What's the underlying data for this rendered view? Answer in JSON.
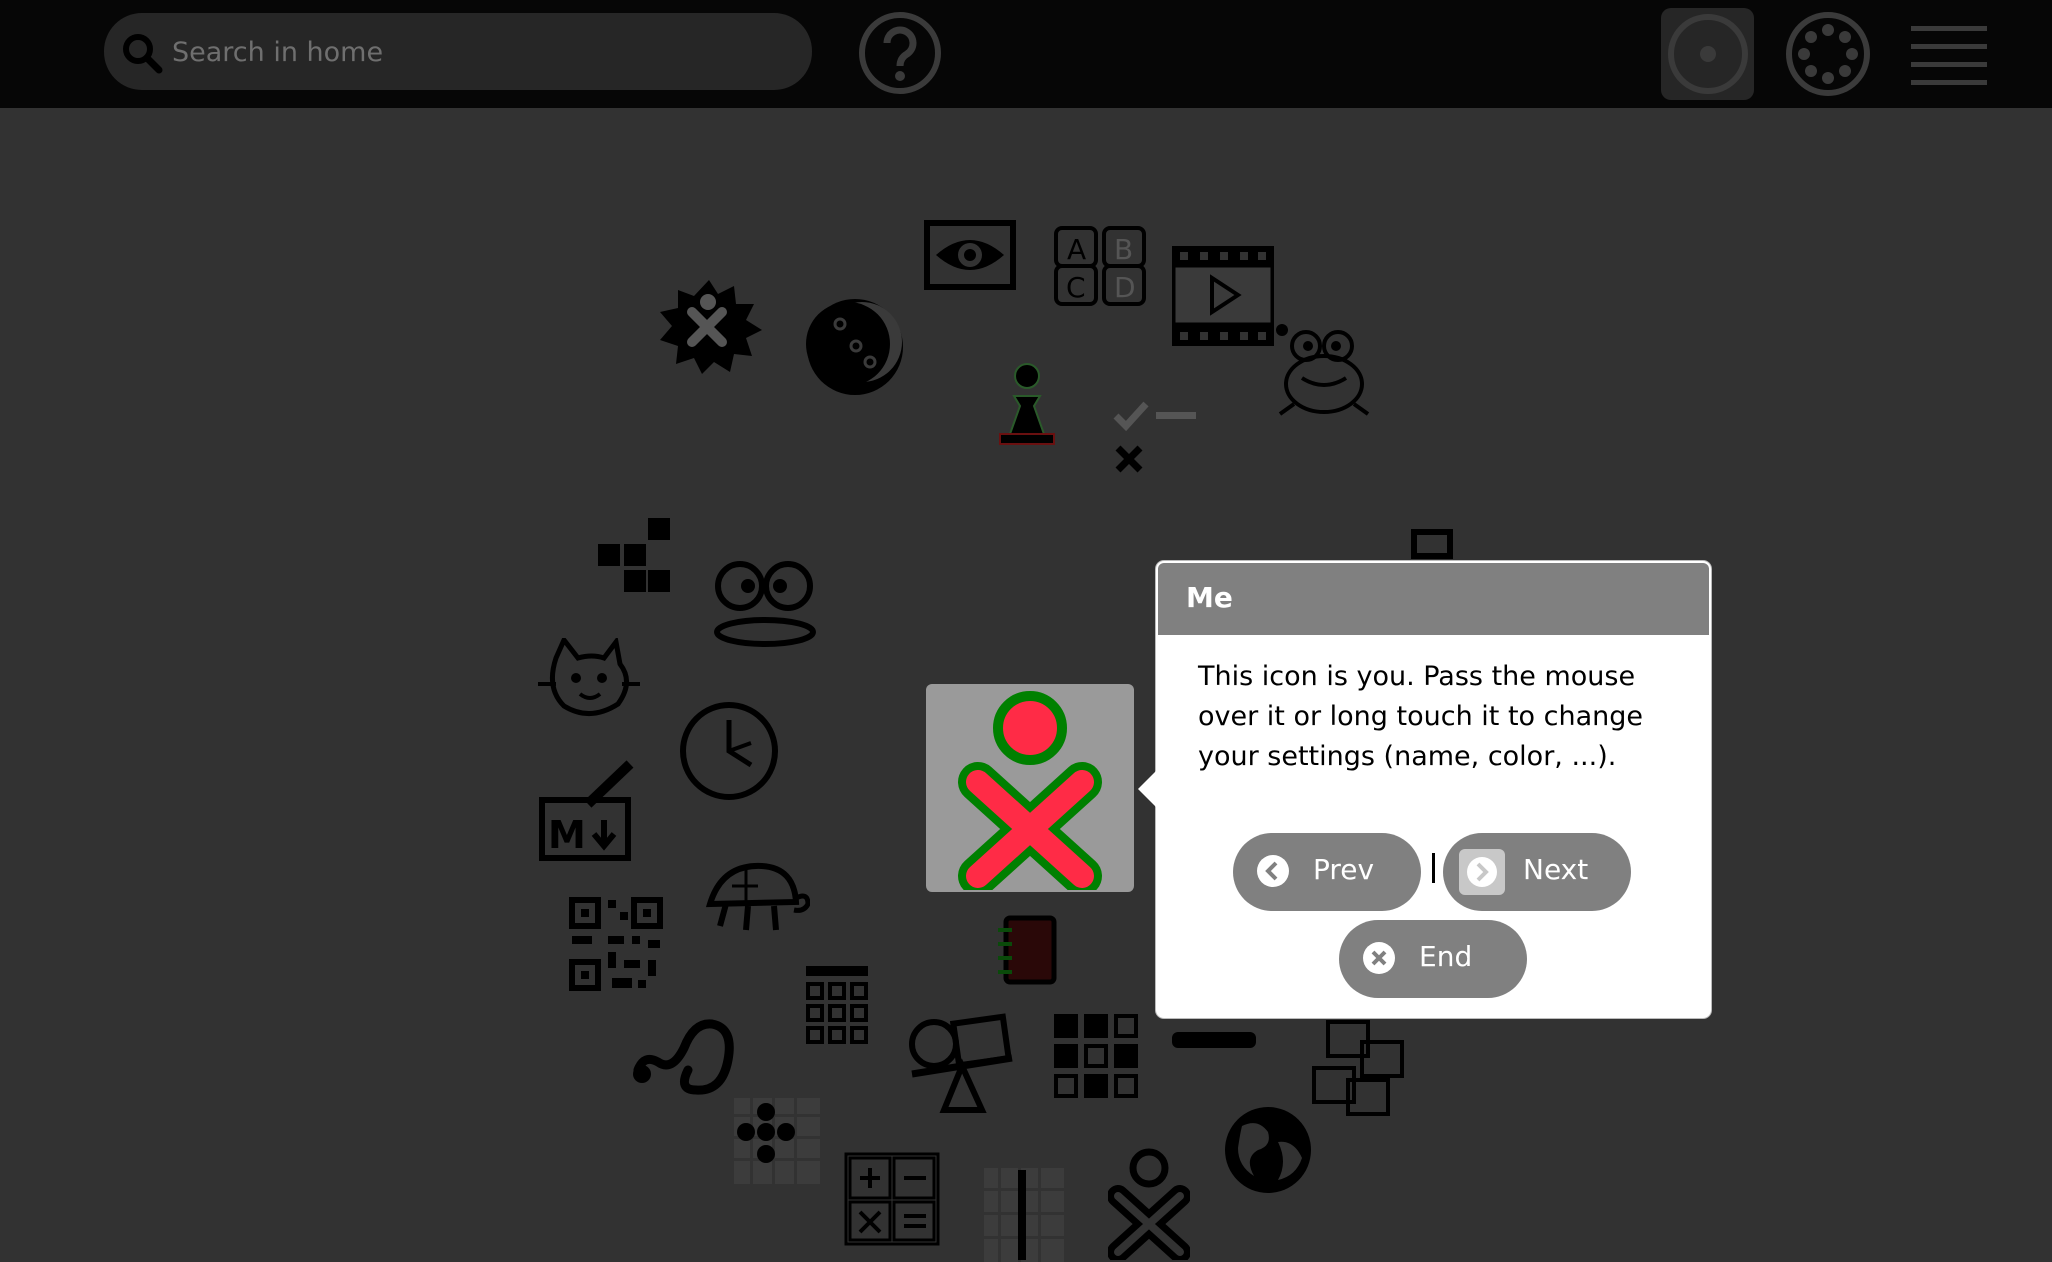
{
  "toolbar": {
    "search_placeholder": "Search in home",
    "icons": [
      "search-icon",
      "help-icon",
      "home-view-icon",
      "neighborhood-view-icon",
      "list-view-icon"
    ]
  },
  "desktop": {
    "activities": [
      "eye-icon",
      "abcd-icon",
      "film-icon",
      "frog-icon",
      "explosion-icon",
      "moon-icon",
      "chess-pawn-icon",
      "checklist-icon",
      "tetris-icon",
      "faces-icon",
      "cat-icon",
      "clock-icon",
      "markdown-icon",
      "turtle-icon",
      "qr-code-icon",
      "calculator-icon",
      "notebook-icon",
      "snake-icon",
      "seesaw-icon",
      "grid-icon",
      "frames-icon",
      "globe-icon",
      "dots-icon",
      "math-icon",
      "abacus-icon",
      "xo-icon"
    ],
    "owner_colors": {
      "stroke": "#008000",
      "fill": "#ff2b46"
    }
  },
  "tutorial": {
    "title": "Me",
    "body": "This icon is you. Pass the mouse over it or long touch it to change your settings (name, color, ...).",
    "prev_label": "Prev",
    "next_label": "Next",
    "end_label": "End"
  },
  "colors": {
    "toolbar": "#060606",
    "background": "#323232",
    "popup_header": "#808080"
  }
}
